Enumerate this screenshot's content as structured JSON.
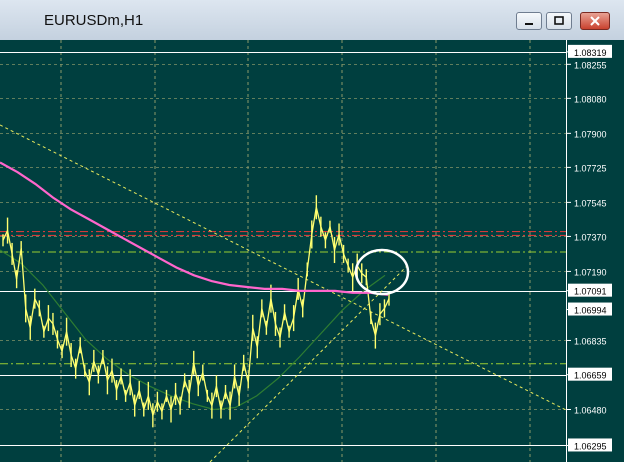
{
  "window": {
    "title": "EURUSDm,H1"
  },
  "icons": {
    "minimize": "minimize-icon",
    "maximize": "maximize-icon",
    "close": "close-icon"
  },
  "colors": {
    "background": "#003f3f",
    "grid": "#8a9a6a",
    "price_series": "#ffff70",
    "moving_average_slow": "#ff66cc",
    "moving_average_fast": "#2e7d32",
    "trendline": "#e8e85c",
    "level_red": "#d23a3a",
    "level_green": "#9acd32",
    "horizontal_line": "#ffffff",
    "highlight_circle": "#ffffff"
  },
  "chart_data": {
    "type": "line",
    "title": "",
    "xlabel": "",
    "ylabel": "",
    "ylim": [
      1.0621,
      1.0838
    ],
    "grid": true,
    "y_tick_labels": [
      "1.08319",
      "1.08255",
      "1.08080",
      "1.07900",
      "1.07725",
      "1.07545",
      "1.07370",
      "1.07190",
      "1.07091",
      "1.06994",
      "1.06835",
      "1.06659",
      "1.06480",
      "1.06295"
    ],
    "highlighted_prices": [
      "1.08319",
      "1.07091",
      "1.06994",
      "1.06659",
      "1.06295"
    ],
    "series": [
      {
        "values": [
          1.0735,
          1.074,
          1.0728,
          1.0715,
          1.0731,
          1.07,
          1.069,
          1.0705,
          1.07,
          1.0688,
          1.0695,
          1.0692,
          1.0684,
          1.0678,
          1.0688,
          1.0676,
          1.0669,
          1.0681,
          1.0668,
          1.0662,
          1.0673,
          1.0666,
          1.0675,
          1.0663,
          1.0668,
          1.0658,
          1.0665,
          1.0655,
          1.0662,
          1.065,
          1.0658,
          1.0648,
          1.0655,
          1.0645,
          1.0652,
          1.0647,
          1.0655,
          1.0648,
          1.0656,
          1.065,
          1.0663,
          1.0656,
          1.0672,
          1.066,
          1.0667,
          1.0655,
          1.065,
          1.066,
          1.0648,
          1.0657,
          1.065,
          1.0665,
          1.0655,
          1.0672,
          1.0662,
          1.069,
          1.068,
          1.07,
          1.069,
          1.0705,
          1.0692,
          1.0685,
          1.0698,
          1.0688,
          1.0695,
          1.071,
          1.07,
          1.072,
          1.0738,
          1.0752,
          1.0742,
          1.0735,
          1.0742,
          1.073,
          1.0738,
          1.0728,
          1.0722,
          1.0716,
          1.0722,
          1.0718,
          1.0716,
          1.0695,
          1.0686,
          1.0697,
          1.07,
          1.0705
        ]
      },
      {
        "values": [
          1.0775,
          1.077,
          1.0764,
          1.0757,
          1.0751,
          1.0746,
          1.0741,
          1.0736,
          1.0731,
          1.0726,
          1.0721,
          1.0717,
          1.0714,
          1.0712,
          1.0711,
          1.071,
          1.071,
          1.0709,
          1.0709,
          1.0709,
          1.0708,
          1.0708,
          1.0707
        ]
      },
      {
        "values": [
          1.073,
          1.0723,
          1.0712,
          1.0698,
          1.0684,
          1.0674,
          1.0666,
          1.066,
          1.0655,
          1.0651,
          1.0648,
          1.0649,
          1.0655,
          1.0664,
          1.0675,
          1.0687,
          1.0699,
          1.0709,
          1.0717
        ]
      }
    ]
  }
}
